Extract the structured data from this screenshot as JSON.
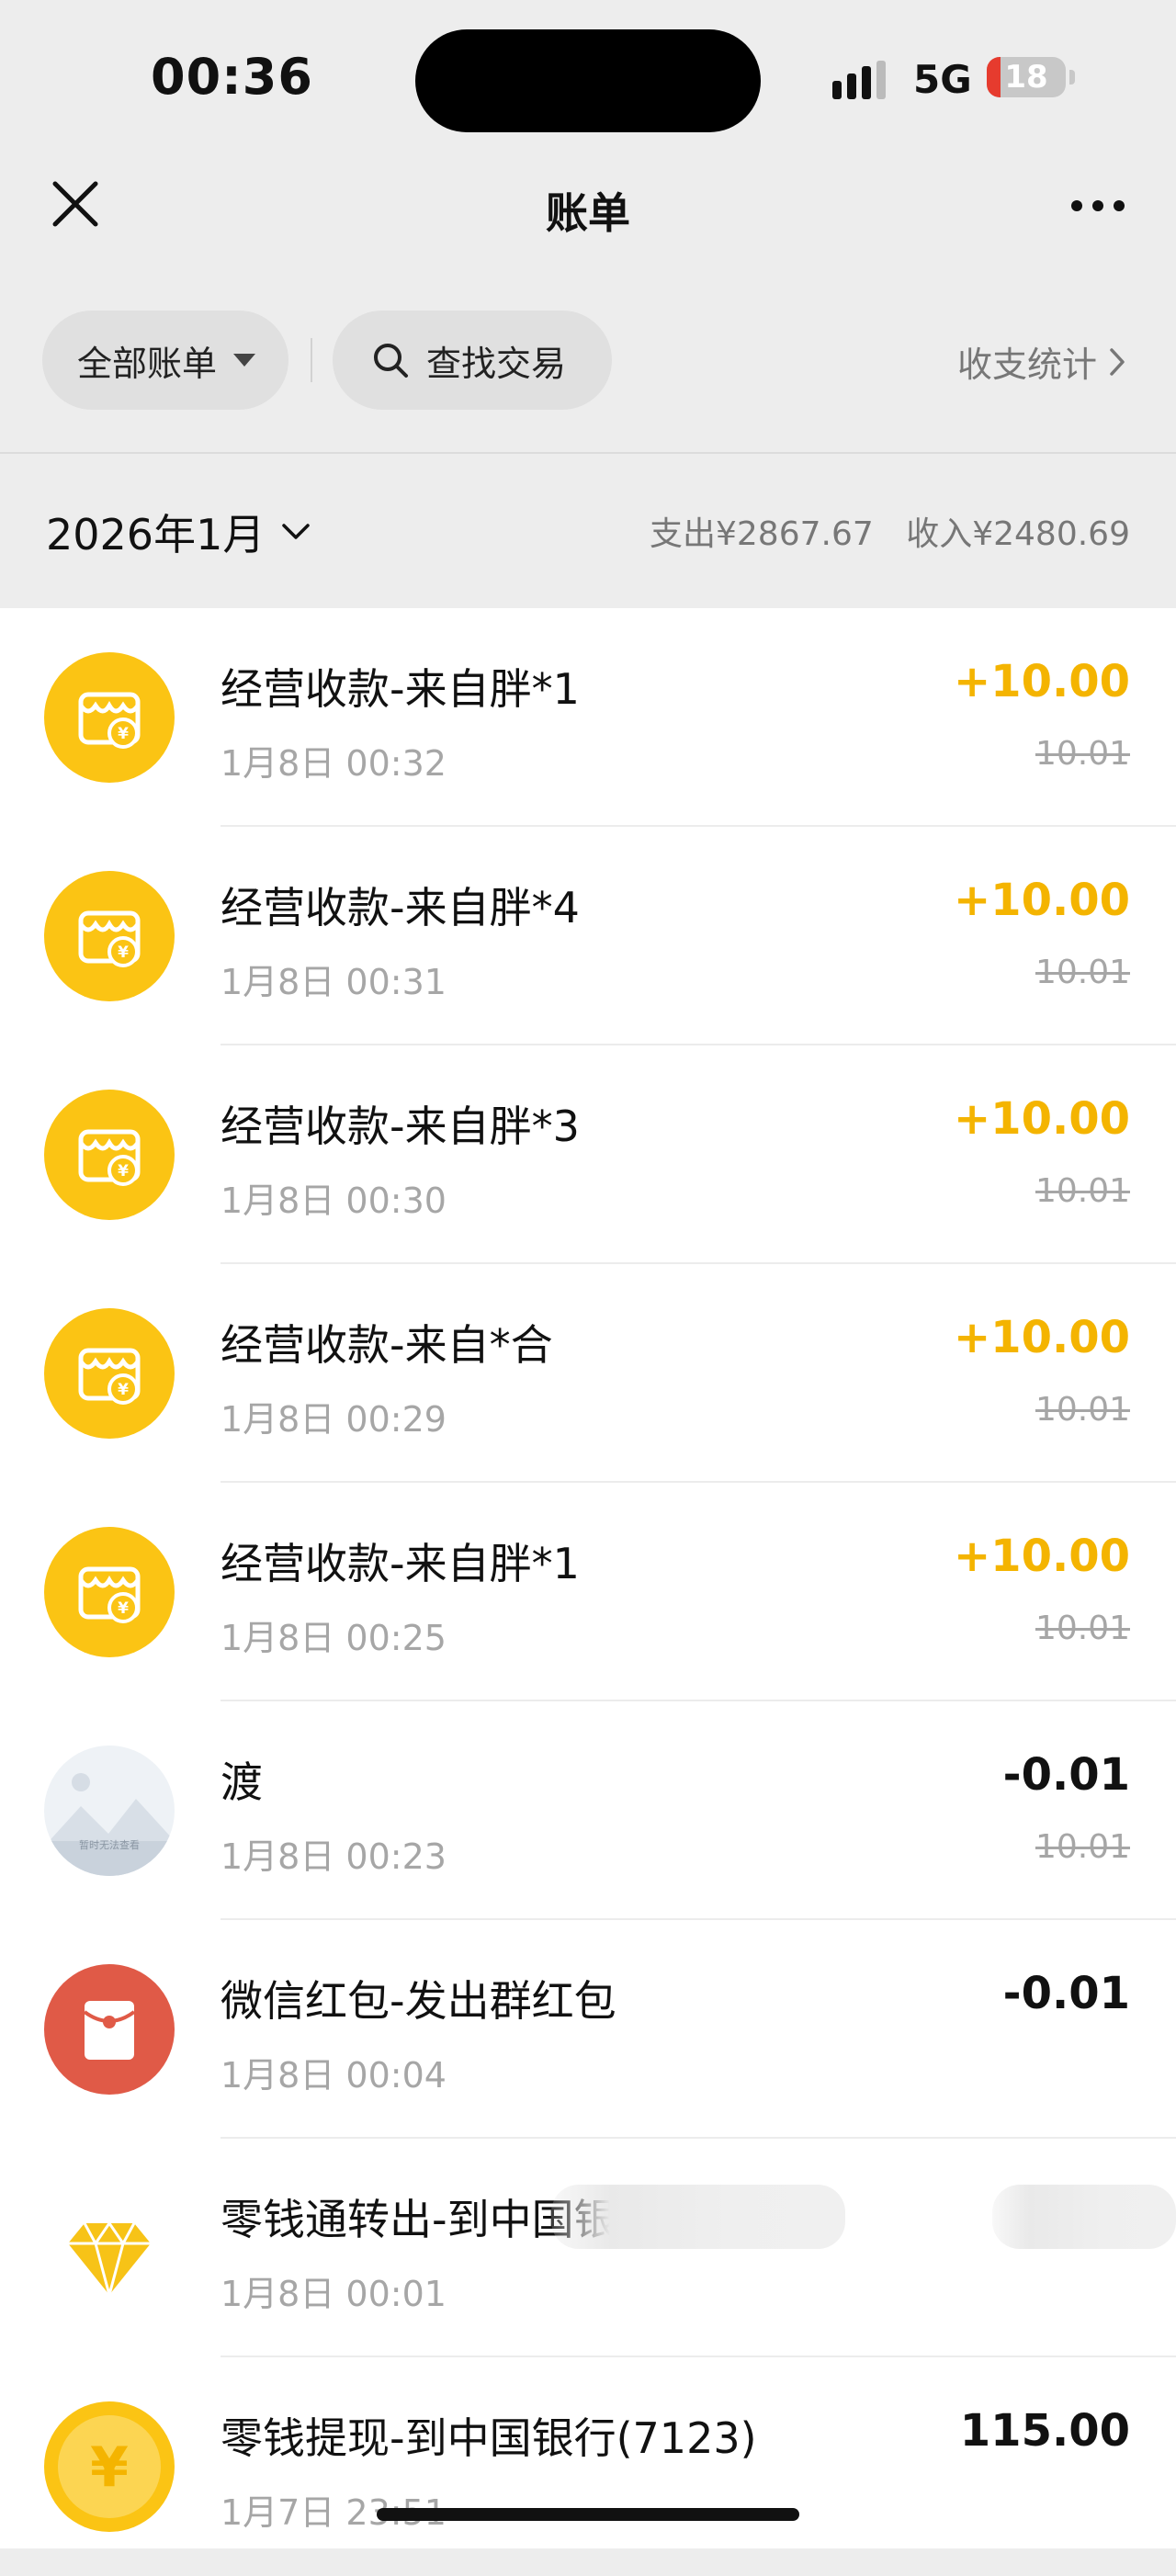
{
  "status_bar": {
    "time": "00:36",
    "network": "5G",
    "battery": "18",
    "battery_level": 0.18
  },
  "nav": {
    "title": "账单",
    "close_icon": "close-icon",
    "more_icon": "more-icon"
  },
  "filters": {
    "all_bills": "全部账单",
    "search": "查找交易",
    "stats": "收支统计"
  },
  "month": {
    "title": "2026年1月",
    "expense": "支出¥2867.67",
    "income": "收入¥2480.69"
  },
  "transactions": [
    {
      "title": "经营收款-来自胖*1",
      "time": "1月8日 00:32",
      "amount": "+10.00",
      "balance": "10.01",
      "icon": "store-icon",
      "type": "income"
    },
    {
      "title": "经营收款-来自胖*4",
      "time": "1月8日 00:31",
      "amount": "+10.00",
      "balance": "10.01",
      "icon": "store-icon",
      "type": "income"
    },
    {
      "title": "经营收款-来自胖*3",
      "time": "1月8日 00:30",
      "amount": "+10.00",
      "balance": "10.01",
      "icon": "store-icon",
      "type": "income"
    },
    {
      "title": "经营收款-来自*合",
      "time": "1月8日 00:29",
      "amount": "+10.00",
      "balance": "10.01",
      "icon": "store-icon",
      "type": "income"
    },
    {
      "title": "经营收款-来自胖*1",
      "time": "1月8日 00:25",
      "amount": "+10.00",
      "balance": "10.01",
      "icon": "store-icon",
      "type": "income"
    },
    {
      "title": "渡",
      "time": "1月8日 00:23",
      "amount": "-0.01",
      "balance": "10.01",
      "icon": "image-unavailable-icon",
      "type": "expense"
    },
    {
      "title": "微信红包-发出群红包",
      "time": "1月8日 00:04",
      "amount": "-0.01",
      "balance": "",
      "icon": "red-packet-icon",
      "type": "expense"
    },
    {
      "title": "零钱通转出-到中国银行(71",
      "time": "1月8日 00:01",
      "amount": "",
      "balance": "",
      "icon": "diamond-icon",
      "type": "expense"
    },
    {
      "title": "零钱提现-到中国银行(7123)",
      "time": "1月7日 23:51",
      "amount": "115.00",
      "balance": "",
      "icon": "yuan-coin-icon",
      "type": "expense"
    }
  ],
  "image_unavailable_text": "暂时无法查看"
}
